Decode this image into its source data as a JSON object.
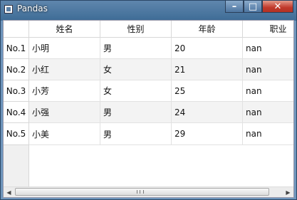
{
  "window": {
    "title": "Pandas",
    "minimize_glyph": "–",
    "maximize_glyph": "□",
    "close_glyph": "✕"
  },
  "table": {
    "columns": [
      "姓名",
      "性别",
      "年龄",
      "职业"
    ],
    "row_headers": [
      "No.1",
      "No.2",
      "No.3",
      "No.4",
      "No.5"
    ],
    "rows": [
      [
        "小明",
        "男",
        "20",
        "nan"
      ],
      [
        "小红",
        "女",
        "21",
        "nan"
      ],
      [
        "小芳",
        "女",
        "25",
        "nan"
      ],
      [
        "小强",
        "男",
        "24",
        "nan"
      ],
      [
        "小美",
        "男",
        "29",
        "nan"
      ]
    ]
  },
  "scrollbar": {
    "left_arrow": "◀",
    "right_arrow": "▶"
  }
}
